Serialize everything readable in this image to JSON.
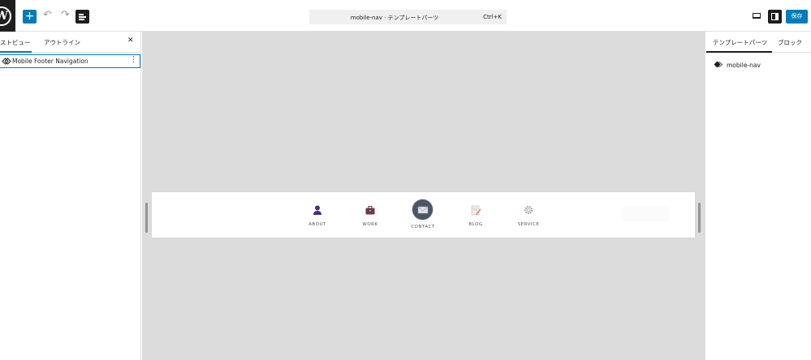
{
  "toolbar": {
    "add_label": "+",
    "undo_glyph": "↶",
    "redo_glyph": "↷",
    "command_title": "mobile-nav · テンプレートパーツ",
    "command_shortcut": "Ctrl+K",
    "save_label": "保存"
  },
  "left_panel": {
    "tab_list_view": "ストビュー",
    "tab_outline": "アウトライン",
    "close_glyph": "✕",
    "tree_item_label": "Mobile Footer Navigation",
    "tree_item_more": "⋮"
  },
  "canvas": {
    "nav_items": [
      {
        "label": "ABOUT",
        "icon": "person-icon",
        "color": "#4a2d7a"
      },
      {
        "label": "WORK",
        "icon": "briefcase-icon",
        "color": "#6b3a4b"
      },
      {
        "label": "CONTACT",
        "icon": "envelope-icon",
        "color": "#4b5563"
      },
      {
        "label": "BLOG",
        "icon": "notepad-pencil-icon",
        "color": "#e07a6a"
      },
      {
        "label": "SERVICE",
        "icon": "gear-icon",
        "color": "#9aa3ad"
      }
    ]
  },
  "right_panel": {
    "tab_template_part": "テンプレートパーツ",
    "tab_block": "ブロック",
    "part_name": "mobile-nav"
  },
  "colors": {
    "accent": "#007cba",
    "dark": "#1e1e1e",
    "canvas_bg": "#dcdcdc"
  }
}
